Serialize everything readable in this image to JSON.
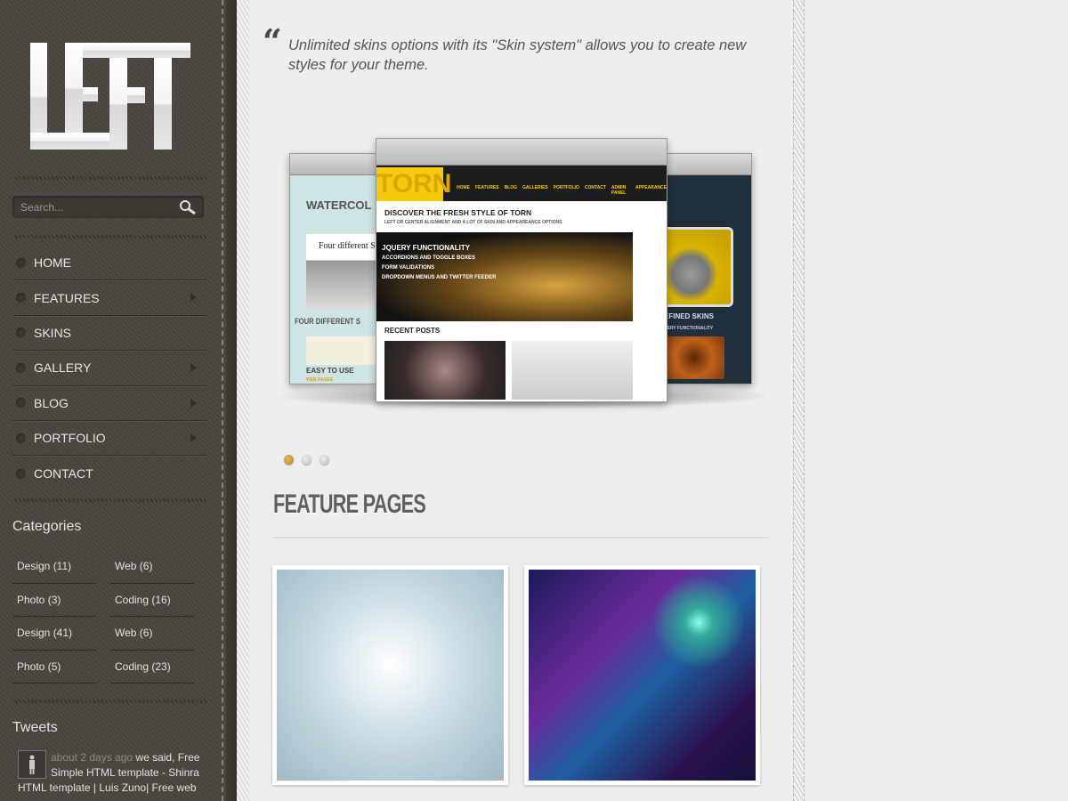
{
  "sidebar": {
    "logo_text": "LEFT",
    "search": {
      "placeholder": "Search..."
    },
    "nav": [
      {
        "label": "HOME",
        "has_submenu": false
      },
      {
        "label": "FEATURES",
        "has_submenu": true
      },
      {
        "label": "SKINS",
        "has_submenu": false
      },
      {
        "label": "GALLERY",
        "has_submenu": true
      },
      {
        "label": "BLOG",
        "has_submenu": true
      },
      {
        "label": "PORTFOLIO",
        "has_submenu": true
      },
      {
        "label": "CONTACT",
        "has_submenu": false
      }
    ],
    "categories_title": "Categories",
    "categories": [
      "Design (11)",
      "Web (6)",
      "Photo (3)",
      "Coding (16)",
      "Design (41)",
      "Web (6)",
      "Photo (5)",
      "Coding (23)"
    ],
    "tweets_title": "Tweets",
    "tweet": {
      "time": "about 2 days ago",
      "text": " we said, Free Simple HTML template - Shinra HTML template | Luis Zuno| Free web"
    }
  },
  "main": {
    "quote": "Unlimited skins options with its \"Skin system\" allows you to create new styles for your theme.",
    "slideshow": {
      "slides_count": 3,
      "active_index": 0,
      "accent": "#f6c90e",
      "center": {
        "logo": "TORN",
        "menu": [
          "HOME",
          "FEATURES",
          "BLOG",
          "GALLERIES",
          "PORTFOLIO",
          "CONTACT",
          "ADMIN PANEL",
          "APPEARANCE"
        ],
        "heading": "DISCOVER THE FRESH STYLE OF TORN",
        "subheading": "LEFT OR CENTER ALIGNMENT AND A LOT OF SKIN AND APPEAREANCE OPTIONS",
        "slide_lines": [
          "JQUERY FUNCTIONALITY",
          "ACCORDIONS AND TOGGLE BOXES",
          "FORM VALIDATIONS",
          "DROPDOWN MENUS AND TWITTER FEEDER"
        ],
        "recent": "RECENT POSTS"
      },
      "left": {
        "logo": "WATERCOL",
        "banner": "Four different SK",
        "caption": "FOUR DIFFERENT S",
        "easy": "EASY TO USE",
        "link": "WEB PAGES"
      },
      "right": {
        "caption": "EFINED SKINS",
        "sub": "UERY FUNCTIONALITY"
      }
    },
    "feature_title": "FEATURE PAGES"
  }
}
